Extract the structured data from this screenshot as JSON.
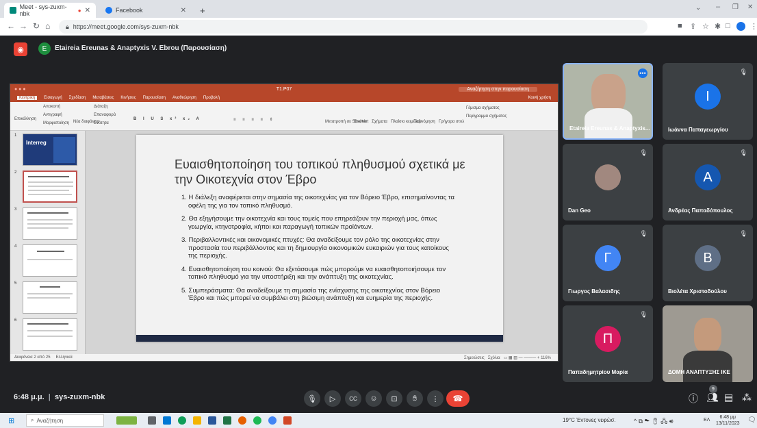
{
  "browser": {
    "tabs": [
      {
        "label": "Meet - sys-zuxm-nbk",
        "active": true
      },
      {
        "label": "Facebook",
        "active": false
      }
    ],
    "url": "https://meet.google.com/sys-zuxm-nbk"
  },
  "meet": {
    "presenter_initial": "E",
    "presentation_title": "Etaireia Ereunas & Anaptyxis V. Ebrou (Παρουσίαση)",
    "time": "6:48 μ.μ.",
    "meeting_code": "sys-zuxm-nbk",
    "raised_count": "9"
  },
  "powerpoint": {
    "file_name": "T1.P07",
    "search_placeholder": "Αναζήτηση στην παρουσίαση",
    "tabs": [
      "Κεντρική",
      "Εισαγωγή",
      "Σχεδίαση",
      "Μεταβάσεις",
      "Κινήσεις",
      "Παρουσίαση",
      "Αναθεώρηση",
      "Προβολή"
    ],
    "share_label": "Κοινή χρήση",
    "ribbon": {
      "paste": "Επικόλληση",
      "cut": "Αποκοπή",
      "copy": "Αντιγραφή",
      "format": "Μορφοποίηση",
      "new_slide": "Νέα διαφάνεια",
      "layout": "Διάταξη",
      "reset": "Επαναφορά",
      "section": "Ενότητα",
      "convert_smartart": "Μετατροπή σε SmartArt",
      "picture": "Εικόνα",
      "shapes": "Σχήματα",
      "textbox": "Πλαίσιο κειμένου",
      "arrange": "Ταξινόμηση",
      "quick_styles": "Γρήγορα στυλ",
      "shape_fill": "Γέμισμα σχήματος",
      "shape_outline": "Περίγραμμα σχήματος"
    },
    "status": {
      "slide_info": "Διαφάνεια 2 από 25",
      "language": "Ελληνικά",
      "notes": "Σημειώσεις",
      "comments": "Σχόλια",
      "zoom": "116%"
    },
    "thumbnail_numbers": [
      "1",
      "2",
      "3",
      "4",
      "5",
      "6"
    ],
    "thumbnail_1_text": "Interreg",
    "slide": {
      "title": "Ευαισθητοποίηση του τοπικού πληθυσμού σχετικά με την Οικοτεχνία στον Έβρο",
      "points": [
        "1. Η διάλεξη αναφέρεται στην σημασία της οικοτεχνίας για τον Βόρειο Έβρο, επισημαίνοντας τα οφέλη της για τον τοπικό πληθυσμό.",
        "2. Θα εξηγήσουμε την οικοτεχνία και τους τομείς που επηρεάζουν την περιοχή μας, όπως γεωργία, κτηνοτροφία, κήποι και παραγωγή τοπικών προϊόντων.",
        "3. Περιβαλλοντικές και οικονομικές πτυχές: Θα αναδείξουμε τον ρόλο της οικοτεχνίας στην προστασία του περιβάλλοντος και τη δημιουργία οικονομικών ευκαιριών για τους κατοίκους της περιοχής.",
        "4. Ευαισθητοποίηση του κοινού: Θα εξετάσουμε πώς μπορούμε να ευαισθητοποιήσουμε τον τοπικό πληθυσμό για την υποστήριξη και την ανάπτυξη της οικοτεχνίας.",
        "5. Συμπεράσματα: Θα αναδείξουμε τη σημασία της ενίσχυσης της οικοτεχνίας στον Βόρειο Έβρο και πώς μπορεί να συμβάλει στη βιώσιμη ανάπτυξη και ευημερία της περιοχής."
      ]
    }
  },
  "participants": [
    {
      "name": "Etaireia Ereunas & Anaptyxis...",
      "initial": "",
      "color": "#5f6368",
      "video": true
    },
    {
      "name": "Ιωάννα Παπαγεωργίου",
      "initial": "Ι",
      "color": "#1a73e8",
      "video": false
    },
    {
      "name": "Dan Geo",
      "initial": "",
      "color": "#8d6e63",
      "video": false
    },
    {
      "name": "Ανδρέας Παπαδόπουλος",
      "initial": "Α",
      "color": "#1557b0",
      "video": false
    },
    {
      "name": "Γιωργος Βαλασιδης",
      "initial": "Γ",
      "color": "#4285f4",
      "video": false
    },
    {
      "name": "Βιολέτα Χριστοδούλου",
      "initial": "Β",
      "color": "#5f6f86",
      "video": false
    },
    {
      "name": "Παπαδημητρίου Μαρία",
      "initial": "Π",
      "color": "#d81b60",
      "video": false
    },
    {
      "name": "ΔΟΜΗ ΑΝΑΠΤΥΞΗΣ ΙΚΕ",
      "initial": "",
      "color": "#5f6368",
      "video": true
    }
  ],
  "taskbar": {
    "search_placeholder": "Αναζήτηση",
    "weather": "19°C Έντονες νεφώσ.",
    "lang": "ΕΛ",
    "time": "6:48 μμ",
    "date": "13/11/2023"
  },
  "colors": {
    "meet_bg": "#202124",
    "tile_bg": "#3c4043",
    "end_call": "#ea4335",
    "ppt_accent": "#b7472a"
  }
}
